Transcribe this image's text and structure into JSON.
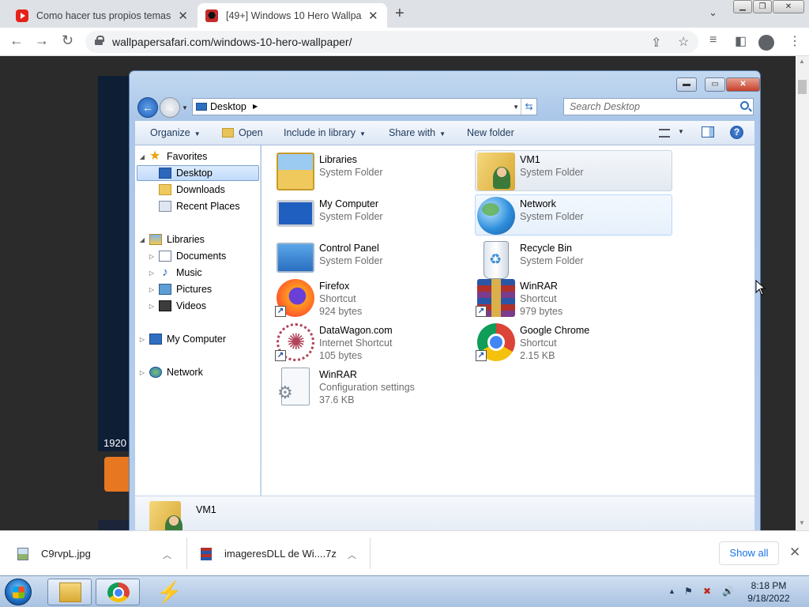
{
  "browser": {
    "tabs": [
      {
        "title": "Como hacer tus propios temas e",
        "favicon": "youtube-icon",
        "active": false
      },
      {
        "title": "[49+] Windows 10 Hero Wallpap",
        "favicon": "wallpapersafari-icon",
        "active": true
      }
    ],
    "url": "wallpapersafari.com/windows-10-hero-wallpaper/"
  },
  "page": {
    "resolution_text": "1920"
  },
  "explorer": {
    "address": {
      "crumb": "Desktop"
    },
    "search_placeholder": "Search Desktop",
    "toolbar": {
      "organize": "Organize",
      "open": "Open",
      "include_in_library": "Include in library",
      "share_with": "Share with",
      "new_folder": "New folder"
    },
    "nav": {
      "favorites": "Favorites",
      "desktop": "Desktop",
      "downloads": "Downloads",
      "recent_places": "Recent Places",
      "libraries": "Libraries",
      "documents": "Documents",
      "music": "Music",
      "pictures": "Pictures",
      "videos": "Videos",
      "my_computer": "My Computer",
      "network": "Network"
    },
    "items": [
      {
        "name": "Libraries",
        "line2": "System Folder",
        "line3": ""
      },
      {
        "name": "VM1",
        "line2": "System Folder",
        "line3": ""
      },
      {
        "name": "My Computer",
        "line2": "System Folder",
        "line3": ""
      },
      {
        "name": "Network",
        "line2": "System Folder",
        "line3": ""
      },
      {
        "name": "Control Panel",
        "line2": "System Folder",
        "line3": ""
      },
      {
        "name": "Recycle Bin",
        "line2": "System Folder",
        "line3": ""
      },
      {
        "name": "Firefox",
        "line2": "Shortcut",
        "line3": "924 bytes"
      },
      {
        "name": "WinRAR",
        "line2": "Shortcut",
        "line3": "979 bytes"
      },
      {
        "name": "DataWagon.com",
        "line2": "Internet Shortcut",
        "line3": "105 bytes"
      },
      {
        "name": "Google Chrome",
        "line2": "Shortcut",
        "line3": "2.15 KB"
      },
      {
        "name": "WinRAR",
        "line2": "Configuration settings",
        "line3": "37.6 KB"
      }
    ],
    "details": {
      "selected_name": "VM1"
    }
  },
  "downloads": [
    {
      "name": "C9rvpL.jpg"
    },
    {
      "name": "imageresDLL de Wi....7z"
    }
  ],
  "shelf": {
    "show_all": "Show all"
  },
  "taskbar": {
    "time": "8:18 PM",
    "date": "9/18/2022"
  }
}
